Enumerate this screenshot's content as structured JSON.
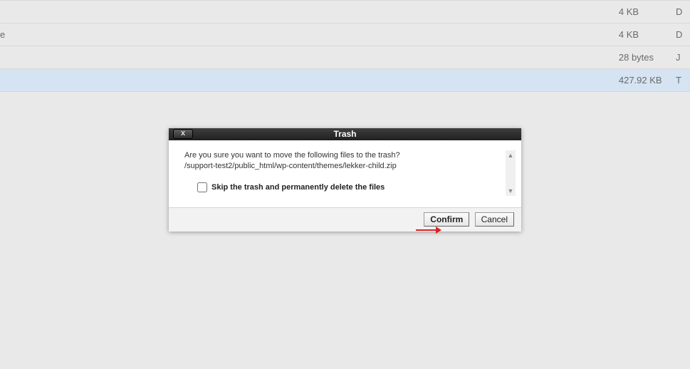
{
  "rows": [
    {
      "name": "",
      "size": "4 KB",
      "type": "D",
      "selected": false
    },
    {
      "name": "e",
      "size": "4 KB",
      "type": "D",
      "selected": false
    },
    {
      "name": "",
      "size": "28 bytes",
      "type": "J",
      "selected": false
    },
    {
      "name": "",
      "size": "427.92 KB",
      "type": "T",
      "selected": true
    }
  ],
  "dialog": {
    "title": "Trash",
    "close": "x",
    "prompt": "Are you sure you want to move the following files to the trash?",
    "file_path": "/support-test2/public_html/wp-content/themes/lekker-child.zip",
    "skip_label": "Skip the trash and permanently delete the files",
    "confirm": "Confirm",
    "cancel": "Cancel",
    "scroll_up": "▲",
    "scroll_down": "▼"
  }
}
